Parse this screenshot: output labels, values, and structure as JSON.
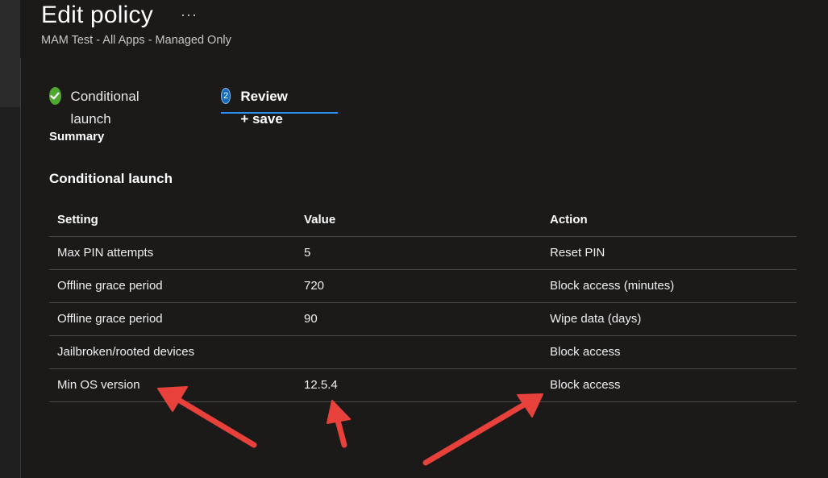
{
  "header": {
    "title": "Edit policy",
    "more_label": "···",
    "subtitle": "MAM Test - All Apps - Managed Only"
  },
  "tabs": [
    {
      "label": "Conditional launch",
      "status": "completed",
      "icon": "check-circle-icon"
    },
    {
      "label": "Review + save",
      "status": "active",
      "step": "2"
    }
  ],
  "summary_heading": "Summary",
  "section_heading": "Conditional launch",
  "table": {
    "columns": [
      "Setting",
      "Value",
      "Action"
    ],
    "rows": [
      [
        "Max PIN attempts",
        "5",
        "Reset PIN"
      ],
      [
        "Offline grace period",
        "720",
        "Block access (minutes)"
      ],
      [
        "Offline grace period",
        "90",
        "Wipe data (days)"
      ],
      [
        "Jailbroken/rooted devices",
        "",
        "Block access"
      ],
      [
        "Min OS version",
        "12.5.4",
        "Block access"
      ]
    ]
  },
  "colors": {
    "background": "#1b1a19",
    "accent": "#2f8ff0",
    "check": "#4ea72e",
    "annotation_arrow": "#e8413b"
  }
}
